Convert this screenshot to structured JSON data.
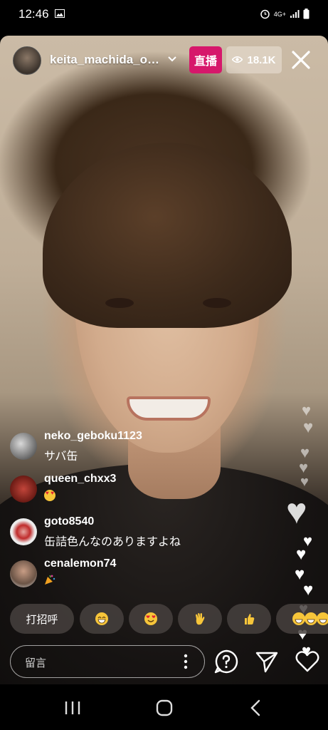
{
  "status_bar": {
    "time": "12:46",
    "network": "4G+"
  },
  "live": {
    "username": "keita_machida_offi...",
    "live_label": "直播",
    "viewer_count": "18.1K"
  },
  "comments": [
    {
      "user": "neko_geboku1123",
      "text": "サバ缶"
    },
    {
      "user": "queen_chxx3",
      "text": ""
    },
    {
      "user": "goto8540",
      "text": "缶詰色んなのありますよね"
    },
    {
      "user": "cenalemon74",
      "text": ""
    }
  ],
  "reactions": {
    "greet_label": "打招呼",
    "items": [
      "grinning-face",
      "heart-eyes-face",
      "waving-hand",
      "thumbs-up",
      "laughing-faces"
    ]
  },
  "input": {
    "placeholder": "留言"
  },
  "colors": {
    "live_badge": "#d6176b",
    "viewer_pill": "#e8ddd2"
  }
}
